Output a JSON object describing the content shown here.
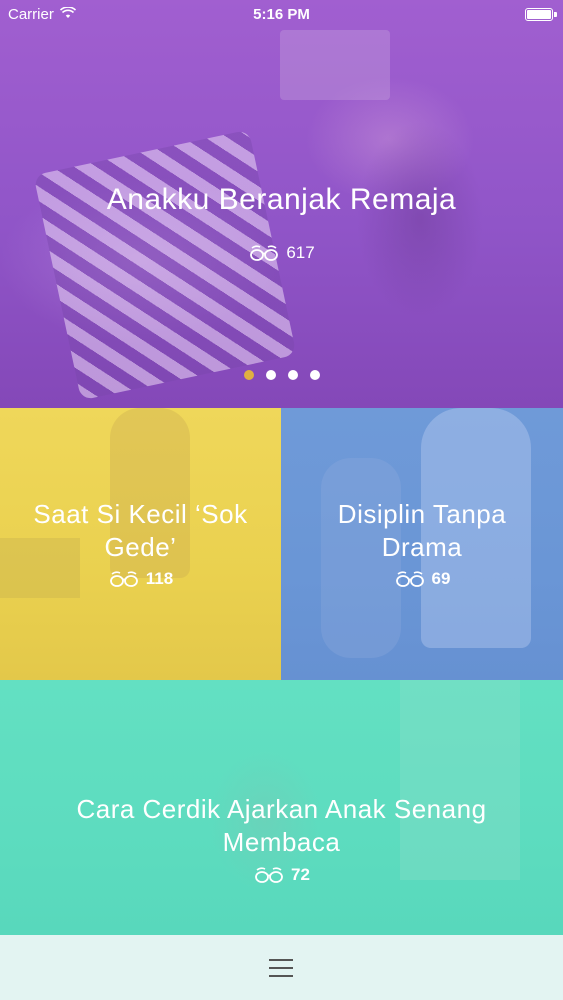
{
  "status_bar": {
    "carrier": "Carrier",
    "time": "5:16 PM"
  },
  "hero": {
    "title": "Anakku Beranjak Remaja",
    "views": "617",
    "page_count": 4,
    "active_page": 1,
    "accent_color": "#9b5cd0"
  },
  "cards": [
    {
      "title": "Saat Si Kecil ‘Sok Gede’",
      "views": "118",
      "color": "#ecd452"
    },
    {
      "title": "Disiplin Tanpa Drama",
      "views": "69",
      "color": "#6e99d8"
    },
    {
      "title": "Cara Cerdik Ajarkan Anak Senang Membaca",
      "views": "72",
      "color": "#60dec0"
    }
  ],
  "icons": {
    "views": "glasses-icon",
    "menu": "hamburger-menu-icon",
    "wifi": "wifi-icon",
    "battery": "battery-icon"
  }
}
